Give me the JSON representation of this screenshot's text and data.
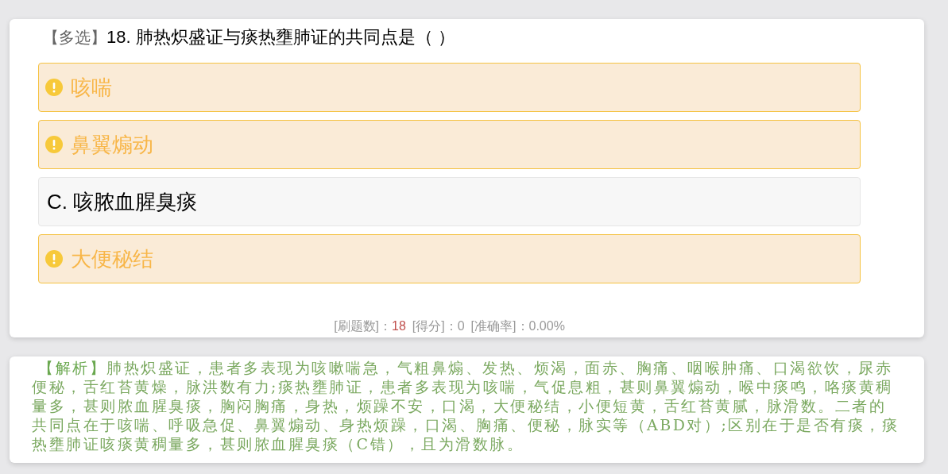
{
  "question": {
    "type_tag": "【多选】",
    "text": "18. 肺热炽盛证与痰热壅肺证的共同点是（   ）"
  },
  "options": [
    {
      "kind": "flagged",
      "label": "咳喘"
    },
    {
      "kind": "flagged",
      "label": "鼻翼煽动"
    },
    {
      "kind": "plain",
      "label": "C. 咳脓血腥臭痰"
    },
    {
      "kind": "flagged",
      "label": "大便秘结"
    }
  ],
  "stats": [
    {
      "label": "[刷题数]：",
      "value": "18",
      "highlight": true
    },
    {
      "label": "[得分]：",
      "value": "0",
      "highlight": false
    },
    {
      "label": "[准确率]：",
      "value": "0.00%",
      "highlight": false
    }
  ],
  "analysis": {
    "tag": "【解析】",
    "text": "肺热炽盛证，患者多表现为咳嗽喘急，气粗鼻煽、发热、烦渴，面赤、胸痛、咽喉肿痛、口渴欲饮，尿赤便秘，舌红苔黄燥，脉洪数有力;痰热壅肺证，患者多表现为咳喘，气促息粗，甚则鼻翼煽动，喉中痰鸣，咯痰黄稠量多，甚则脓血腥臭痰，胸闷胸痛，身热，烦躁不安，口渴，大便秘结，小便短黄，舌红苔黄腻，脉滑数。二者的共同点在于咳喘、呼吸急促、鼻翼煽动、身热烦躁，口渴、胸痛、便秘，脉实等（ABD对）;区别在于是否有痰，痰热壅肺证咳痰黄稠量多，甚则脓血腥臭痰（C错），且为滑数脉。"
  }
}
